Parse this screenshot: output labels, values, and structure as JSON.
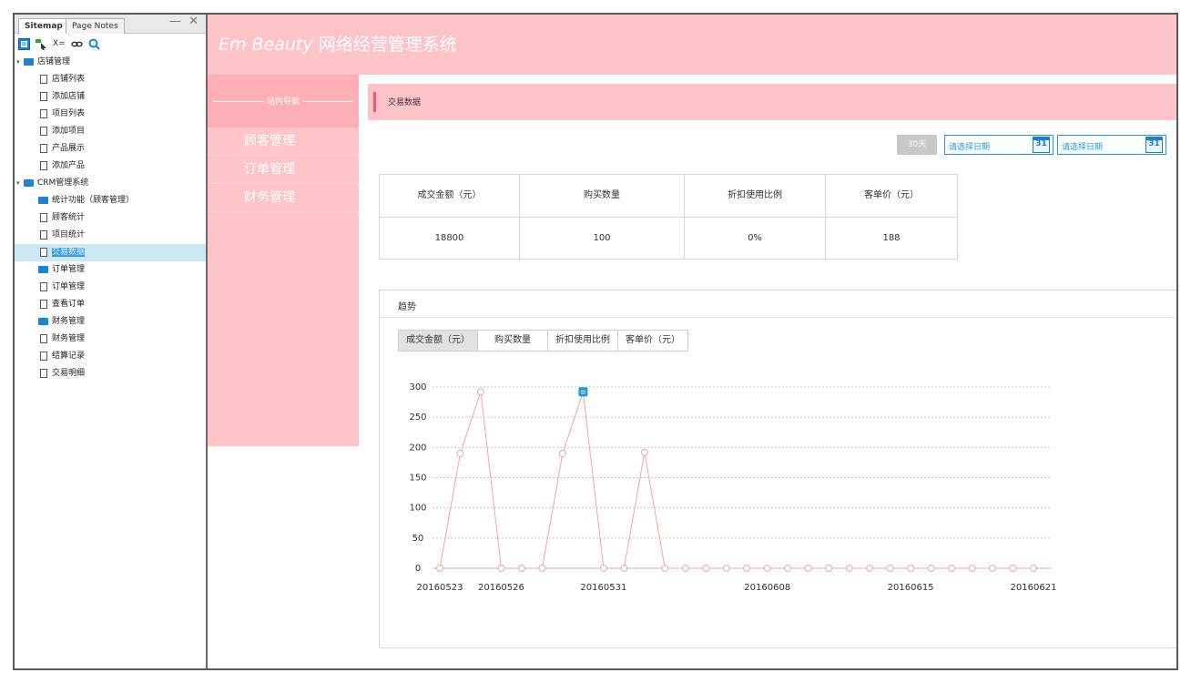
{
  "sitemap": {
    "tabs": [
      "Sitemap",
      "Page Notes"
    ],
    "window_buttons": "— ✕",
    "toolbar_text": "X=",
    "tree": [
      {
        "label": "店铺管理",
        "type": "folder",
        "level": 0,
        "caret": true
      },
      {
        "label": "店铺列表",
        "type": "page",
        "level": 1
      },
      {
        "label": "添加店铺",
        "type": "page",
        "level": 1
      },
      {
        "label": "项目列表",
        "type": "page",
        "level": 1
      },
      {
        "label": "添加项目",
        "type": "page",
        "level": 1
      },
      {
        "label": "产品展示",
        "type": "page",
        "level": 1
      },
      {
        "label": "添加产品",
        "type": "page",
        "level": 1
      },
      {
        "label": "CRM管理系统",
        "type": "folder",
        "level": 0,
        "caret": true
      },
      {
        "label": "统计功能（顾客管理）",
        "type": "folder",
        "level": 1
      },
      {
        "label": "顾客统计",
        "type": "page",
        "level": 1
      },
      {
        "label": "项目统计",
        "type": "page",
        "level": 1
      },
      {
        "label": "交易数据",
        "type": "page",
        "level": 1,
        "selected": true
      },
      {
        "label": "订单管理",
        "type": "folder",
        "level": 1
      },
      {
        "label": "订单管理",
        "type": "page",
        "level": 1
      },
      {
        "label": "查看订单",
        "type": "page",
        "level": 1
      },
      {
        "label": "财务管理",
        "type": "folder",
        "level": 1
      },
      {
        "label": "财务管理",
        "type": "page",
        "level": 1
      },
      {
        "label": "结算记录",
        "type": "page",
        "level": 1
      },
      {
        "label": "交易明细",
        "type": "page",
        "level": 1
      }
    ]
  },
  "header": {
    "title_en": "Em Beauty",
    "title_cn": "网络经营管理系统"
  },
  "leftnav": {
    "heading": "站内导航",
    "items": [
      "顾客管理",
      "订单管理",
      "财务管理"
    ]
  },
  "section": {
    "title": "交易数据"
  },
  "filters": {
    "range_button": "30天",
    "start_placeholder": "请选择日期",
    "end_placeholder": "请选择日期",
    "calendar_day": "31"
  },
  "stats": {
    "headers": [
      "成交金额（元）",
      "购买数量",
      "折扣使用比例",
      "客单价（元）"
    ],
    "values": [
      "18800",
      "100",
      "0%",
      "188"
    ]
  },
  "trend": {
    "title": "趋势",
    "tabs": [
      "成交金额（元）",
      "购买数量",
      "折扣使用比例",
      "客单价（元）"
    ],
    "active_tab": 0
  },
  "colors": {
    "banner": "#ffc4c8",
    "accent": "#ff4f7b",
    "line": "#f4a4a8",
    "date_blue": "#1f9ae0"
  },
  "chart_data": {
    "type": "line",
    "ylim": [
      0,
      300
    ],
    "yticks": [
      0,
      50,
      100,
      150,
      200,
      250,
      300
    ],
    "x": [
      "20160523",
      "20160524",
      "20160525",
      "20160526",
      "20160527",
      "20160528",
      "20160529",
      "20160530",
      "20160531",
      "20160601",
      "20160602",
      "20160603",
      "20160604",
      "20160605",
      "20160606",
      "20160607",
      "20160608",
      "20160609",
      "20160610",
      "20160611",
      "20160612",
      "20160613",
      "20160614",
      "20160615",
      "20160616",
      "20160617",
      "20160618",
      "20160619",
      "20160620",
      "20160621"
    ],
    "xtick_labels": [
      "20160523",
      "20160526",
      "20160531",
      "20160608",
      "20160615",
      "20160621"
    ],
    "values": [
      0,
      190,
      292,
      0,
      0,
      0,
      190,
      292,
      0,
      0,
      192,
      0,
      0,
      0,
      0,
      0,
      0,
      0,
      0,
      0,
      0,
      0,
      0,
      0,
      0,
      0,
      0,
      0,
      0,
      0
    ],
    "grid": true,
    "highlight_index": 7
  }
}
